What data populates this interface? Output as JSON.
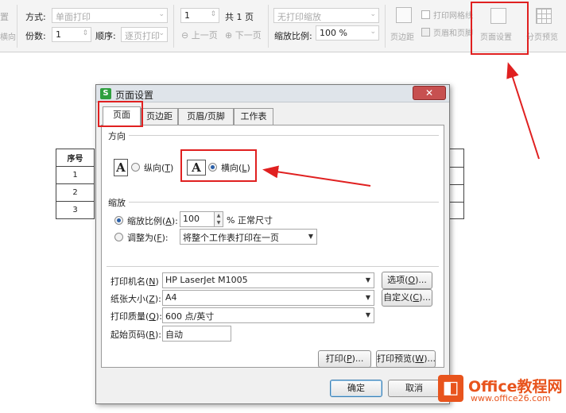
{
  "toolbar": {
    "style_label": "方式:",
    "style_value": "单面打印",
    "copies_label": "份数:",
    "copies_value": "1",
    "order_label": "顺序:",
    "order_value": "逐页打印",
    "page_from": "1",
    "page_total": "共 1 页",
    "prev_page": "上一页",
    "next_page": "下一页",
    "scaling_value": "无打印缩放",
    "zoom_label": "缩放比例:",
    "zoom_value": "100 %",
    "margins_label": "页边距",
    "print_gridlines_label": "打印网格线",
    "header_footer_label": "页眉和页脚",
    "page_setup_label": "页面设置",
    "page_break_preview_label": "分页预览",
    "left_cut_top": "置",
    "left_cut_bottom": "横向"
  },
  "sheet": {
    "header": "序号",
    "rows": [
      "1",
      "2",
      "3"
    ]
  },
  "dialog": {
    "title": "页面设置",
    "close": "✕",
    "tabs": [
      "页面",
      "页边距",
      "页眉/页脚",
      "工作表"
    ],
    "orientation": {
      "group_label": "方向",
      "portrait_label": "纵向",
      "portrait_key": "T",
      "landscape_label": "横向",
      "landscape_key": "L",
      "selected": "landscape"
    },
    "scaling": {
      "group_label": "缩放",
      "scale_label": "缩放比例",
      "scale_key": "A",
      "scale_value": "100",
      "scale_suffix": "% 正常尺寸",
      "fit_label": "调整为",
      "fit_key": "F",
      "fit_value": "将整个工作表打印在一页"
    },
    "printer": {
      "name_label": "打印机名",
      "name_key": "N",
      "name_value": "HP LaserJet M1005",
      "options_button": "选项",
      "options_key": "O",
      "paper_label": "纸张大小",
      "paper_key": "Z",
      "paper_value": "A4",
      "custom_button": "自定义",
      "custom_key": "C",
      "quality_label": "打印质量",
      "quality_key": "Q",
      "quality_value": "600 点/英寸",
      "first_page_label": "起始页码",
      "first_page_key": "R",
      "first_page_value": "自动"
    },
    "print_button": "打印",
    "print_key": "P",
    "preview_button": "打印预览",
    "preview_key": "W",
    "ok_button": "确定",
    "cancel_button": "取消"
  },
  "watermark": {
    "title": "Office教程网",
    "url": "www.office26.com"
  },
  "colors": {
    "annotation_red": "#e02020",
    "watermark_orange": "#e8541d"
  }
}
